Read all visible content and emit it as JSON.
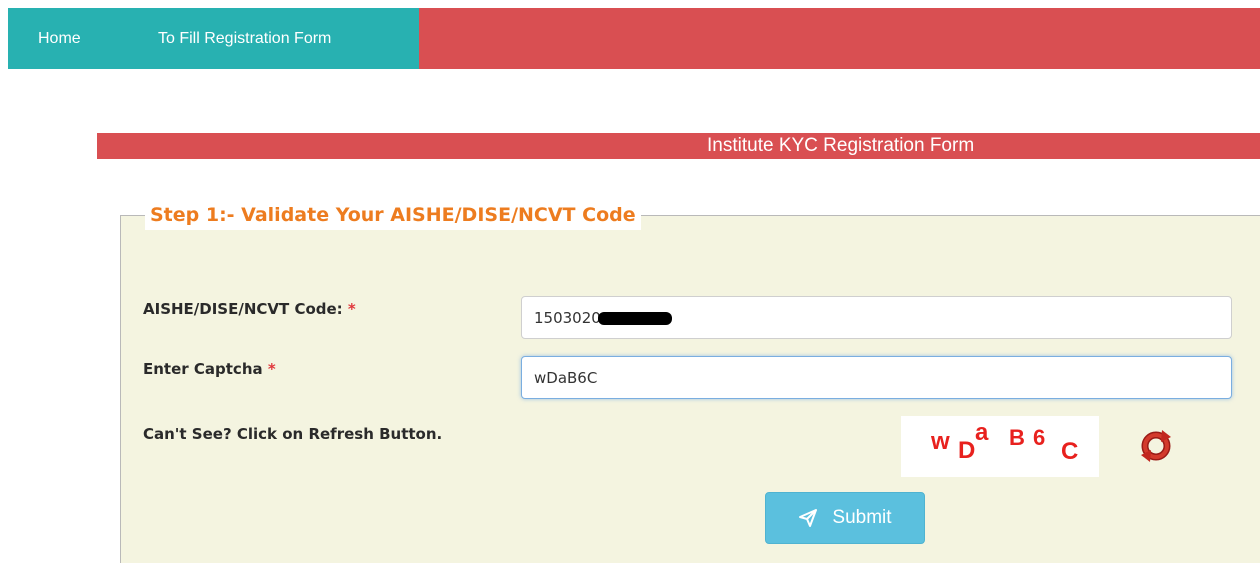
{
  "nav": {
    "home_label": "Home",
    "register_label": "To Fill Registration Form"
  },
  "title_bar": {
    "title": "Institute KYC Registration Form"
  },
  "step": {
    "legend": "Step 1:- Validate Your AISHE/DISE/NCVT Code",
    "code_label": "AISHE/DISE/NCVT Code:",
    "code_value": "1503020",
    "captcha_label": "Enter Captcha",
    "captcha_value": "wDaB6C",
    "required_marker": "*",
    "refresh_hint": "Can't See? Click on Refresh Button.",
    "captcha_chars": [
      "w",
      "D",
      "a",
      "B",
      "6",
      "C"
    ],
    "submit_label": "Submit"
  },
  "icons": {
    "refresh": "refresh-icon",
    "submit": "paper-plane-icon"
  },
  "colors": {
    "nav_red": "#d94f52",
    "nav_teal": "#28b1b1",
    "legend_orange": "#ed7c1f",
    "panel_bg": "#f4f4e0",
    "submit_blue": "#5bc0de",
    "captcha_red": "#e8211e"
  }
}
